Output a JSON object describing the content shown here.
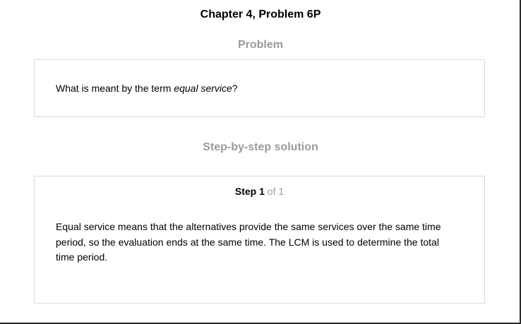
{
  "header": {
    "title": "Chapter 4, Problem 6P"
  },
  "problem": {
    "heading": "Problem",
    "text_before": "What is meant by the term ",
    "text_emphasis": "equal service",
    "text_after": "?"
  },
  "solution": {
    "heading": "Step-by-step solution",
    "step": {
      "label_word": "Step",
      "label_number": "1",
      "label_of": "of 1",
      "text": "Equal service means that the alternatives provide the same services over the same time period, so the evaluation ends at the same time. The LCM is used to determine the total time period."
    }
  }
}
